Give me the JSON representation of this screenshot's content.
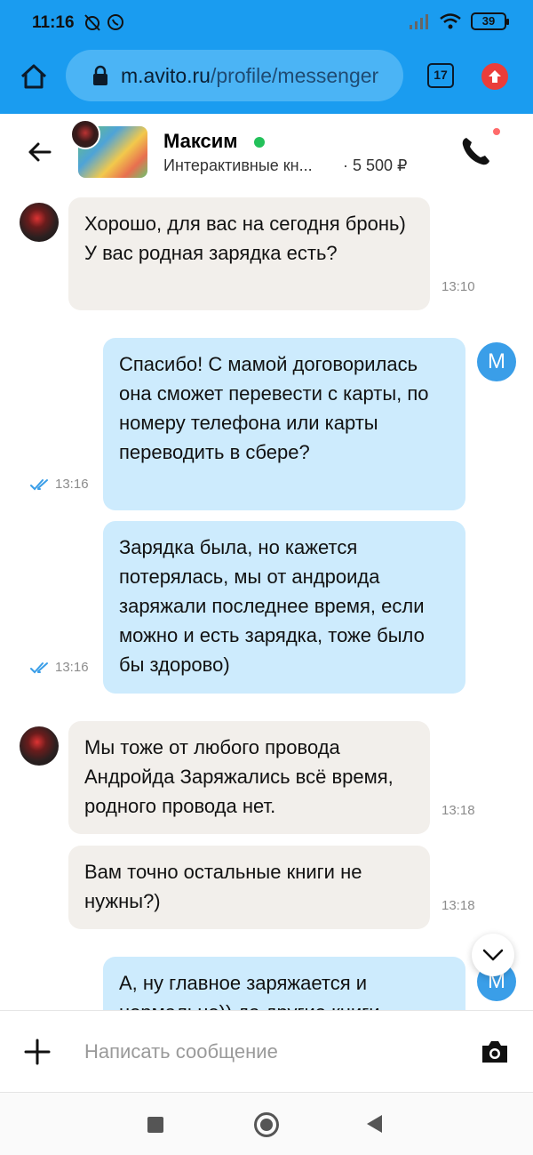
{
  "status_bar": {
    "time": "11:16",
    "battery": "39"
  },
  "browser": {
    "url_host": "m.avito.ru",
    "url_path": "/profile/messenger",
    "tab_count": "17"
  },
  "chat_header": {
    "name": "Максим",
    "item_title": "Интерактивные кн...",
    "price": "· 5 500 ₽"
  },
  "messages": [
    {
      "from": "in",
      "text": "Хорошо, для вас на сегодня бронь) У вас родная зарядка есть?",
      "time": "13:10"
    },
    {
      "from": "out",
      "text": "Спасибо! С мамой договорилась она сможет перевести с карты, по номеру телефона или карты переводить в сбере?",
      "time": "13:16"
    },
    {
      "from": "out",
      "text": "Зарядка была, но кажется потерялась, мы от андроида заряжали последнее время, если можно и есть зарядка, тоже было бы здорово)",
      "time": "13:16"
    },
    {
      "from": "in",
      "text": "Мы тоже от любого провода Андройда Заряжались всё время, родного провода нет.",
      "time": "13:18"
    },
    {
      "from": "in",
      "text": "Вам точно остальные книги не нужны?)",
      "time": "13:18"
    },
    {
      "from": "out",
      "text": "А, ну главное заряжается и нормально)) да другие книги",
      "time": ""
    }
  ],
  "my_avatar_letter": "М",
  "composer": {
    "placeholder": "Написать сообщение"
  },
  "colors": {
    "browser_bar": "#1a9cf0",
    "bubble_in": "#f2efeb",
    "bubble_out": "#cdebfd",
    "online": "#23c15a",
    "read_ticks": "#3a9ee8"
  }
}
